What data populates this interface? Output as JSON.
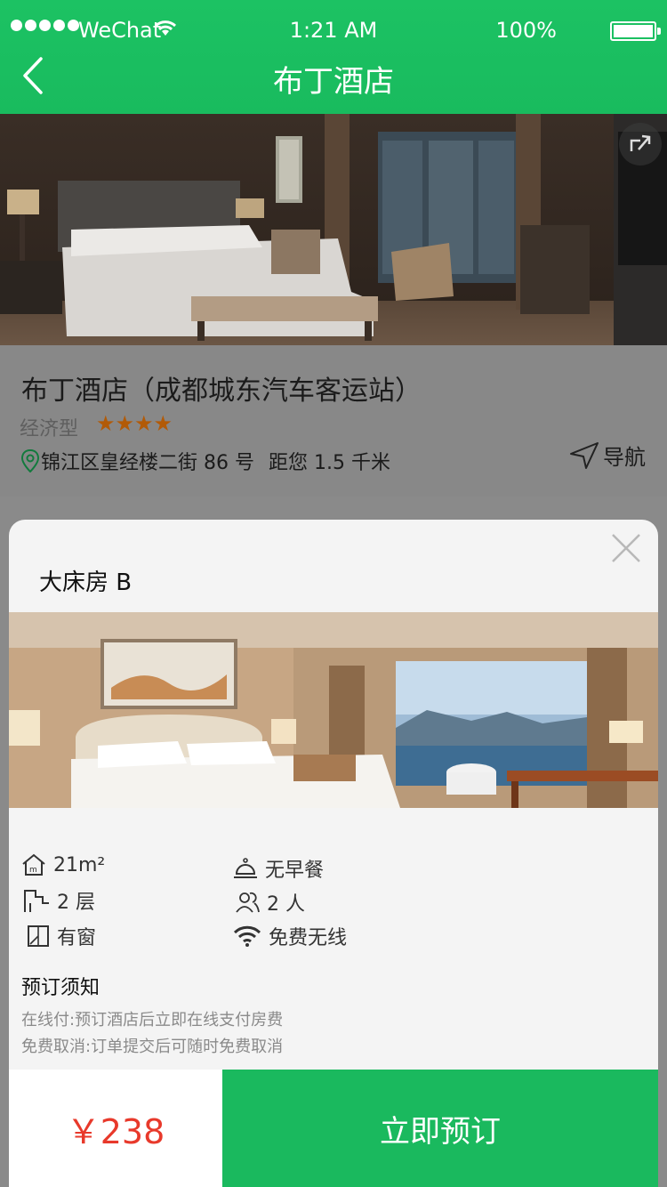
{
  "status_bar": {
    "carrier": "WeChat",
    "time": "1:21 AM",
    "battery_pct": "100%"
  },
  "nav": {
    "title": "布丁酒店"
  },
  "hotel": {
    "name": "布丁酒店（成都城东汽车客运站）",
    "type": "经济型",
    "star_rating": 4,
    "stars": "★★★★",
    "address": "锦江区皇经楼二街 86 号",
    "distance": "距您 1.5 千米",
    "navigate_label": "导航"
  },
  "room_modal": {
    "room_name": "大床房 B",
    "features": {
      "area": "21m²",
      "floor": "2 层",
      "window": "有窗",
      "breakfast": "无早餐",
      "guests": "2 人",
      "wifi": "免费无线"
    },
    "notice_title": "预订须知",
    "notice_lines": [
      "在线付:预订酒店后立即在线支付房费",
      "免费取消:订单提交后可随时免费取消"
    ]
  },
  "booking": {
    "price": "￥238",
    "book_label": "立即预订"
  },
  "colors": {
    "brand_green": "#1ab95e",
    "price_red": "#e8392b",
    "star_orange": "#b25a07"
  }
}
